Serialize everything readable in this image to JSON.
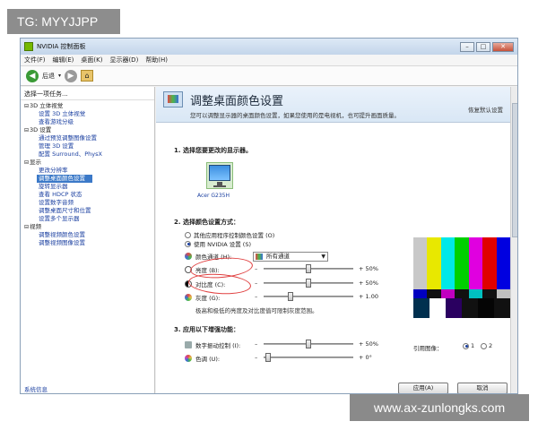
{
  "overlay": {
    "tag_text": "TG: MYYJJPP",
    "watermark": "www.ax-zunlongks.com"
  },
  "window": {
    "title": "NVIDIA 控制面板",
    "menu": [
      "文件(F)",
      "编辑(E)",
      "桌面(K)",
      "显示器(D)",
      "帮助(H)"
    ],
    "back_label": "后退"
  },
  "sidebar": {
    "header": "选择一项任务...",
    "categories": [
      {
        "label": "3D 立体视觉",
        "items": [
          "设置 3D 立体视觉",
          "查看游戏分级"
        ]
      },
      {
        "label": "3D 设置",
        "items": [
          "通过预览调整图像设置",
          "管理 3D 设置",
          "配置 Surround、PhysX"
        ]
      },
      {
        "label": "显示",
        "items": [
          "更改分辨率",
          "调整桌面颜色设置",
          "旋转显示器",
          "查看 HDCP 状态",
          "设置数字音频",
          "调整桌面尺寸和位置",
          "设置多个显示器"
        ]
      },
      {
        "label": "视频",
        "items": [
          "调整视频颜色设置",
          "调整视频图像设置"
        ]
      }
    ],
    "selected_item": "调整桌面颜色设置",
    "footer": "系统信息"
  },
  "main": {
    "title": "调整桌面颜色设置",
    "restore_link": "恢复默认设置",
    "subtitle": "您可以调整显示器的桌面颜色设置，如果您使用的是电视机，也可提升画面质量。",
    "section1": "1. 选择您要更改的显示器。",
    "monitor_label": "Acer G235H",
    "section2": "2. 选择颜色设置方式：",
    "radio1": "其他应用程序控制颜色设置 (O)",
    "radio2": "使用 NVIDIA 设置 (S)",
    "channel_label": "颜色通道 (H):",
    "channel_value": "所有通道",
    "brightness": {
      "label": "亮度 (B):",
      "value": "+ 50%",
      "level": 0.5
    },
    "contrast": {
      "label": "对比度 (C):",
      "value": "+ 50%",
      "level": 0.5
    },
    "gamma": {
      "label": "灰度 (G):",
      "value": "+ 1.00",
      "level": 0.3
    },
    "note": "极高和极低的亮度及对比度值可限制灰度范围。",
    "section3": "3. 应用以下增强功能：",
    "vibrance": {
      "label": "数字振动控制 (I):",
      "value": "+ 50%",
      "level": 0.5
    },
    "hue": {
      "label": "色调 (U):",
      "value": "+ 0°",
      "level": 0.05
    },
    "reference_label": "引用图像：",
    "ref_options": [
      "1",
      "2"
    ],
    "apply_button": "应用(A)",
    "cancel_button": "取消",
    "test_colors_top": [
      "#c8c8c8",
      "#e8e800",
      "#00e8e8",
      "#00d000",
      "#e000e0",
      "#e00000",
      "#0000e0"
    ],
    "test_colors_mid": [
      "#0000c0",
      "#111111",
      "#c000c0",
      "#111111",
      "#00c0c0",
      "#111111",
      "#c0c0c0"
    ],
    "test_colors_low": [
      "#00304f",
      "#ffffff",
      "#2a0060",
      "#111111",
      "#050505",
      "#111111"
    ]
  },
  "colors": {
    "accent": "#3b79c8",
    "nvidia_green": "#76b900",
    "annotation_red": "#e04040"
  }
}
